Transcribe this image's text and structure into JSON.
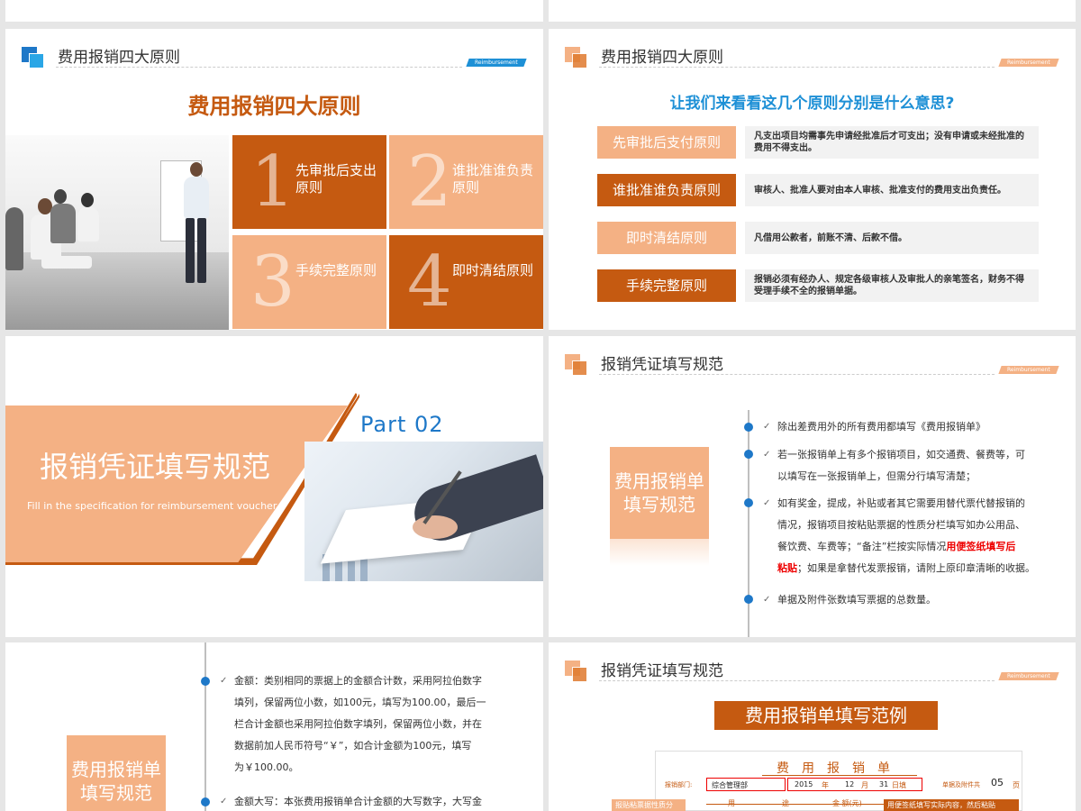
{
  "header_tag": "Reimbursement",
  "slide1": {
    "header_title": "费用报销四大原则",
    "big_title": "费用报销四大原则",
    "tiles": [
      {
        "num": "1",
        "label": "先审批后支出原则"
      },
      {
        "num": "2",
        "label": "谁批准谁负责原则"
      },
      {
        "num": "3",
        "label": "手续完整原则"
      },
      {
        "num": "4",
        "label": "即时清结原则"
      }
    ]
  },
  "slide2": {
    "header_title": "费用报销四大原则",
    "question": "让我们来看看这几个原则分别是什么意思?",
    "rules": [
      {
        "name": "先审批后支付原则",
        "desc": "凡支出项目均需事先申请经批准后才可支出；没有申请或未经批准的费用不得支出。"
      },
      {
        "name": "谁批准谁负责原则",
        "desc": "审核人、批准人要对由本人审核、批准支付的费用支出负责任。"
      },
      {
        "name": "即时清结原则",
        "desc": "凡借用公款者，前账不清、后款不借。"
      },
      {
        "name": "手续完整原则",
        "desc": "报销必须有经办人、规定各级审核人及审批人的亲笔签名，财务不得受理手续不全的报销单据。"
      }
    ]
  },
  "slide3": {
    "title": "报销凭证填写规范",
    "subtitle": "Fill in the specification for reimbursement voucher",
    "part": "Part   02"
  },
  "slide4": {
    "header_title": "报销凭证填写规范",
    "side_label": "费用报销单填写规范",
    "bullets": [
      {
        "text": "除出差费用外的所有费用都填写《费用报销单》"
      },
      {
        "lines": [
          "若一张报销单上有多个报销项目，如交通费、餐费等，可",
          "以填写在一张报销单上，但需分行填写清楚；"
        ]
      },
      {
        "lines": [
          "如有奖金，提成，补贴或者其它需要用替代票代替报销的",
          "情况，报销项目按粘贴票据的性质分栏填写如办公用品、",
          "餐饮费、车费等；“备注”栏按实际情况"
        ],
        "highlight": "用便签纸填写后",
        "line4_highlight": "粘贴",
        "line4_rest": "；如果是拿替代发票报销，请附上原印章清晰的收据。"
      },
      {
        "text": "单据及附件张数填写票据的总数量。"
      }
    ]
  },
  "slide5": {
    "side_label": "费用报销单填写规范",
    "bullets": [
      {
        "lines": [
          "金额：类别相同的票据上的金额合计数，采用阿拉伯数字",
          "填列，保留两位小数，如100元，填写为100.00，最后一",
          "栏合计金额也采用阿拉伯数字填列，保留两位小数，并在",
          "数据前加人民币符号“￥”，如合计金额为100元，填写",
          "为￥100.00。"
        ]
      },
      {
        "lines": [
          "金额大写：本张费用报销单合计金额的大写数字，大写金"
        ]
      }
    ]
  },
  "slide6": {
    "header_title": "报销凭证填写规范",
    "banner": "费用报销单填写范例",
    "form": {
      "title": "费用报销单",
      "dept_label": "报销部门:",
      "dept_value": "综合管理部",
      "year": "2015",
      "year_label": "年",
      "month": "12",
      "month_label": "月",
      "day": "31",
      "day_label": "日填",
      "attach_label": "单据及附件共",
      "attach_value": "05",
      "attach_unit": "页",
      "col_use": "用",
      "col_way": "途",
      "col_amount": "金  额(元)",
      "col_note": "备"
    },
    "note_left": "报贴粘票据性质分",
    "note_right": "用便签纸填写实际内容，然后粘贴"
  },
  "colors": {
    "orange_dark": "#c55a11",
    "orange_light": "#f4b184",
    "blue": "#1e90d6"
  }
}
